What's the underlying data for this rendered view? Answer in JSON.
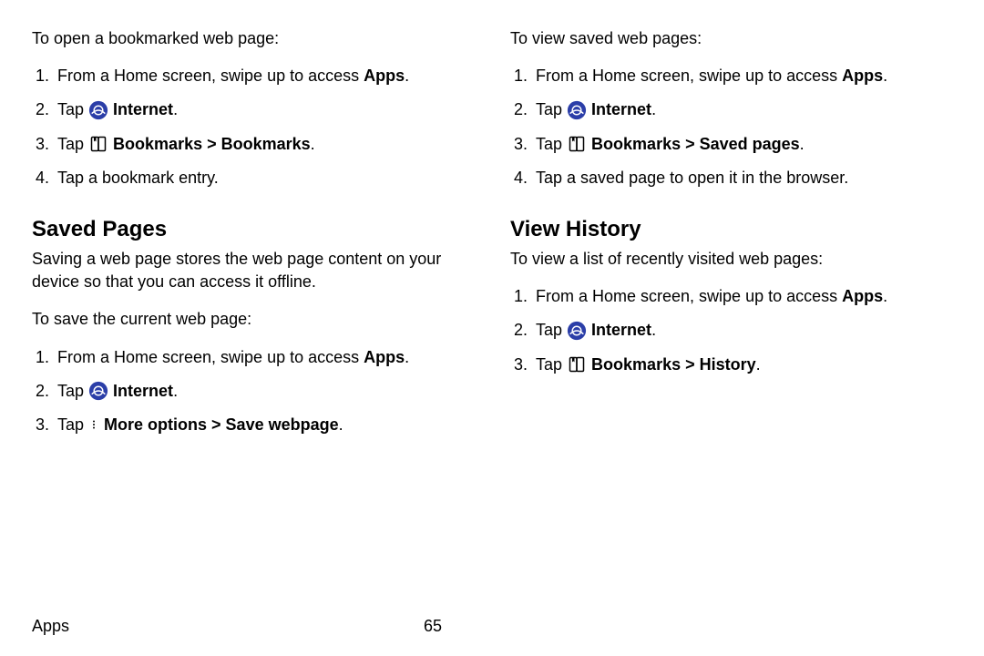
{
  "left": {
    "open_intro": "To open a bookmarked web page:",
    "open_steps": {
      "s1_pre": "From a Home screen, swipe up to access ",
      "s1_bold": "Apps",
      "s1_post": ".",
      "s2_pre": "Tap ",
      "s2_bold": "Internet",
      "s2_post": ".",
      "s3_pre": "Tap ",
      "s3_bold": "Bookmarks > Bookmarks",
      "s3_post": ".",
      "s4": "Tap a bookmark entry."
    },
    "saved_heading": "Saved Pages",
    "saved_desc": "Saving a web page stores the web page content on your device so that you can access it offline.",
    "save_intro": "To save the current web page:",
    "save_steps": {
      "s1_pre": "From a Home screen, swipe up to access ",
      "s1_bold": "Apps",
      "s1_post": ".",
      "s2_pre": "Tap ",
      "s2_bold": "Internet",
      "s2_post": ".",
      "s3_pre": "Tap ",
      "s3_bold": "More options > Save webpage",
      "s3_post": "."
    }
  },
  "right": {
    "view_intro": "To view saved web pages:",
    "view_steps": {
      "s1_pre": "From a Home screen, swipe up to access ",
      "s1_bold": "Apps",
      "s1_post": ".",
      "s2_pre": "Tap ",
      "s2_bold": "Internet",
      "s2_post": ".",
      "s3_pre": "Tap ",
      "s3_bold": "Bookmarks > Saved pages",
      "s3_post": ".",
      "s4": "Tap a saved page to open it in the browser."
    },
    "history_heading": "View History",
    "history_intro": "To view a list of recently visited web pages:",
    "history_steps": {
      "s1_pre": "From a Home screen, swipe up to access ",
      "s1_bold": "Apps",
      "s1_post": ".",
      "s2_pre": "Tap ",
      "s2_bold": "Internet",
      "s2_post": ".",
      "s3_pre": "Tap ",
      "s3_bold": "Bookmarks > History",
      "s3_post": "."
    }
  },
  "footer": {
    "section": "Apps",
    "page": "65"
  }
}
